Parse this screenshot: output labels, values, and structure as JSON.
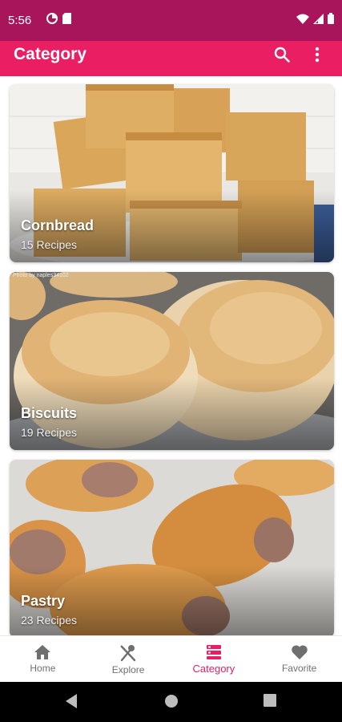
{
  "status_bar": {
    "time": "5:56",
    "left_icons": [
      "data-saver-icon",
      "sim-card-icon"
    ],
    "right_icons": [
      "wifi-icon",
      "signal-icon",
      "battery-icon"
    ]
  },
  "app_bar": {
    "title": "Category",
    "actions": [
      "search-icon",
      "more-vert-icon"
    ]
  },
  "categories": [
    {
      "name": "Cornbread",
      "count": "15 Recipes"
    },
    {
      "name": "Biscuits",
      "count": "19 Recipes",
      "photo_credit": "Photo by naples34102"
    },
    {
      "name": "Pastry",
      "count": "23 Recipes"
    }
  ],
  "bottom_nav": {
    "items": [
      {
        "label": "Home",
        "icon": "home-icon",
        "active": false
      },
      {
        "label": "Explore",
        "icon": "fork-spoon-icon",
        "active": false
      },
      {
        "label": "Category",
        "icon": "category-icon",
        "active": true
      },
      {
        "label": "Favorite",
        "icon": "heart-icon",
        "active": false
      }
    ]
  },
  "colors": {
    "status_bar": "#a8155b",
    "app_bar": "#e91e63",
    "accent": "#e91e63",
    "nav_inactive": "#6f6f6f"
  },
  "system_nav": [
    "back-icon",
    "home-circle-icon",
    "recents-icon"
  ]
}
